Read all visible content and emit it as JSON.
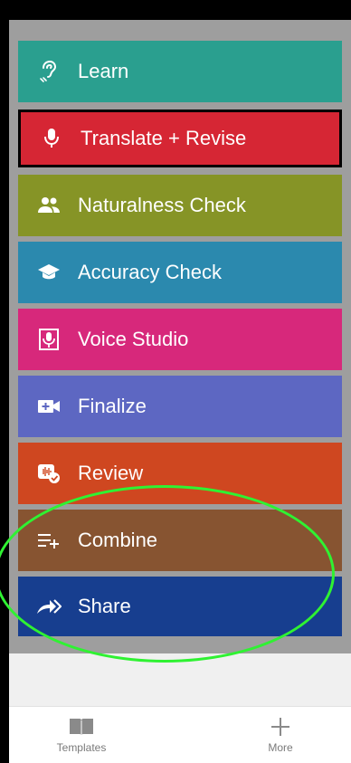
{
  "steps": [
    {
      "label": "Learn",
      "color": "#2a9f8f",
      "icon": "ear-icon"
    },
    {
      "label": "Translate + Revise",
      "color": "#d62634",
      "icon": "microphone-icon",
      "selected": true
    },
    {
      "label": "Naturalness Check",
      "color": "#869426",
      "icon": "people-icon"
    },
    {
      "label": "Accuracy Check",
      "color": "#2b89ae",
      "icon": "graduation-cap-icon"
    },
    {
      "label": "Voice Studio",
      "color": "#d7287b",
      "icon": "voice-recorder-icon"
    },
    {
      "label": "Finalize",
      "color": "#5d67c2",
      "icon": "video-add-icon"
    },
    {
      "label": "Review",
      "color": "#cf4720",
      "icon": "audio-check-icon"
    },
    {
      "label": "Combine",
      "color": "#875431",
      "icon": "playlist-add-icon"
    },
    {
      "label": "Share",
      "color": "#173e8f",
      "icon": "share-arrow-icon"
    }
  ],
  "tabbar": {
    "templates_label": "Templates",
    "more_label": "More",
    "templates_icon": "book-icon",
    "more_icon": "plus-icon"
  },
  "annotation": {
    "color": "#2ff232"
  }
}
